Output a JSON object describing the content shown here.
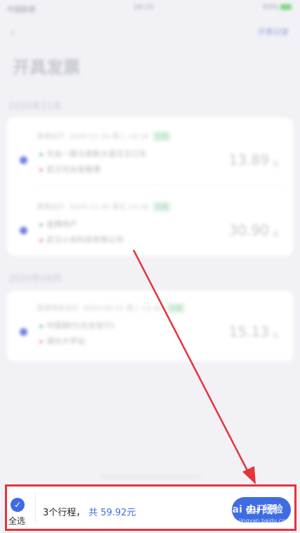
{
  "status_bar": {
    "carrier": "中国联通",
    "time": "16:15",
    "battery": "93%"
  },
  "nav": {
    "back_glyph": "‹",
    "right_link": "开票记录"
  },
  "page_title": "开具发票",
  "months": [
    {
      "label": "2020年11月",
      "trips": [
        {
          "type": "滴滴出行",
          "time": "2020-11-24 周二 14:16",
          "tag": "已完",
          "from": "光谷一路与高新大道交叉口东",
          "to": "武汉光谷金融港",
          "amount": "13.89",
          "unit": "元"
        },
        {
          "type": "滴滴出行",
          "time": "2020-11-20 周五 10:28",
          "tag": "已完",
          "from": "金隅地产",
          "to": "武汉小米科技有限公司",
          "amount": "30.90",
          "unit": "元"
        }
      ]
    },
    {
      "label": "2020年09月",
      "trips": [
        {
          "type": "滴滴快车出行",
          "time": "2020-09-22 周二 12:42",
          "tag": "已完",
          "from": "中国银行(光谷支行)",
          "to": "湖北大学站",
          "amount": "15.13",
          "unit": "元"
        }
      ]
    }
  ],
  "bottom_bar": {
    "select_all_label": "全选",
    "trip_count": "3个行程，",
    "total": "共 59.92元",
    "submit_label": "去开票"
  },
  "watermark": {
    "brand": "Bai du 经验",
    "url": "jingyan.baidu.com"
  },
  "colors": {
    "accent": "#3f6ce2",
    "highlight": "#e5343a",
    "background": "#f2f2f6"
  },
  "icons": {
    "select_all": "check-circle-icon",
    "back": "chevron-left-icon"
  }
}
